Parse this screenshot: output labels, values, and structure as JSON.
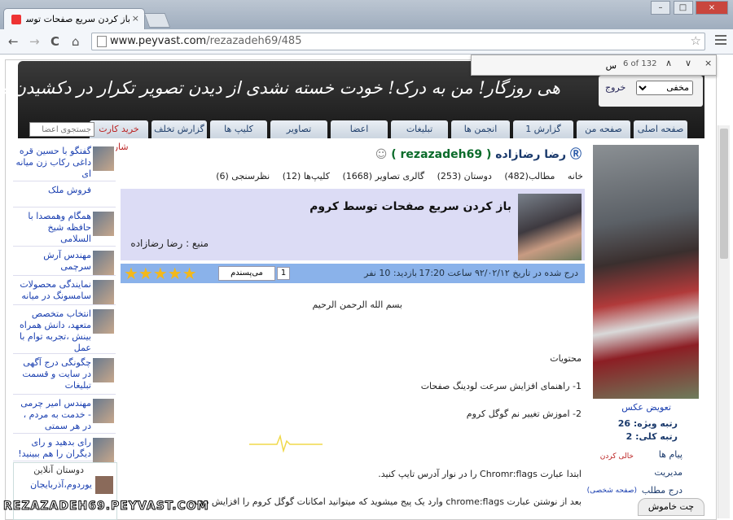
{
  "browser": {
    "tab_title": "باز کردن سریع صفحات توسط کروم - رضا رضازاده",
    "tab_close": "×",
    "url_host": "www.peyvast.com",
    "url_path": "/rezazadeh69/485",
    "window_buttons": [
      "–",
      "□",
      "×"
    ],
    "nav_back": "←",
    "nav_forward": "→",
    "nav_reload": "C",
    "nav_home": "⌂",
    "star": "☆"
  },
  "findbar": {
    "query": "س",
    "count": "6 of 132",
    "prev": "∧",
    "next": "∨",
    "close": "×"
  },
  "header": {
    "slogan": "هی روزگار! من به درک! خودت خسته نشدی از دیدن تصویر تکرار در دکشیدن من؟",
    "status_select": "مخفی",
    "logout": "خروج"
  },
  "menu": {
    "items": [
      "صفحه اصلی",
      "صفحه من",
      "گزارش 1",
      "انجمن ها",
      "تبلیغات",
      "اعضا",
      "تصاویر",
      "کلیپ ها",
      "گزارش تخلف",
      "خرید کارت شارژ"
    ],
    "search_placeholder": "جستجوی اعضا"
  },
  "left_list": [
    "گفتگو با حسین قره داغی رکاب زن میانه ای",
    "فروش ملک",
    "همگام وهمصدا با حافظه شیخ السلامی",
    "مهندس آرش سرچمی",
    "نمایندگی محصولات سامسونگ در میانه",
    "انتخاب متخصص متعهد، دانش همراه بینش ،تجربه توام با عمل",
    "چگونگی درج آگهی در سایت و قسمت تبلیغات",
    "مهندس امیر چرمی - خدمت به مردم ، در هر سمتی",
    "رای بدهید و رای دیگران را هم ببینید!"
  ],
  "online": {
    "heading": "دوستان آنلاین",
    "user": "یوردوم،آذربایجان"
  },
  "profile": {
    "name": "رضا رضازاده",
    "username": "( rezazadeh69 )",
    "tabs": [
      "خانه",
      "مطالب(482)",
      "دوستان (253)",
      "گالری تصاویر (1668)",
      "کلیپ‌ها (12)",
      "نظرسنجی (6)"
    ]
  },
  "post": {
    "title": "باز کردن سریع صفحات توسط کروم",
    "source": "منبع : رضا رضازاده",
    "date": "درج شده در تاریخ ۹۲/۰۲/۱۲ ساعت 17:20",
    "visits": "بازدید: 10 نفر",
    "like_label": "می‌پسندم",
    "like_count": "1",
    "stars": "★★★★★",
    "basmala": "بسم الله الرحمن الرحیم",
    "contents": "محتویات",
    "item1": "1- راهنمای افزایش سرعت لودینگ صفحات",
    "item2": "2- اموزش تغییر نم گوگل کروم",
    "para1": "ابتدا عبارت  Chromr:flags را در نوار آدرس تایپ کنید.",
    "para2": "بعد از نوشتن عبارت chrome:flags وارد یک پیج میشوید که میتوانید امکانات گوگل کروم را افزایش دهید."
  },
  "sidebar_right": {
    "change_photo": "تعویض عکس",
    "special_rank": "رتبه ویژه:  26",
    "total_rank": "رتبه کلی:  2",
    "messages": "پیام ها",
    "messages_status": "خالی کردن",
    "manage": "مدیریت",
    "publish": "درج مطلب",
    "publish_note": "(صفحه شخصی)"
  },
  "chat": "چت خاموش",
  "watermark": "REZAZADEH69.PEYVAST.COM"
}
